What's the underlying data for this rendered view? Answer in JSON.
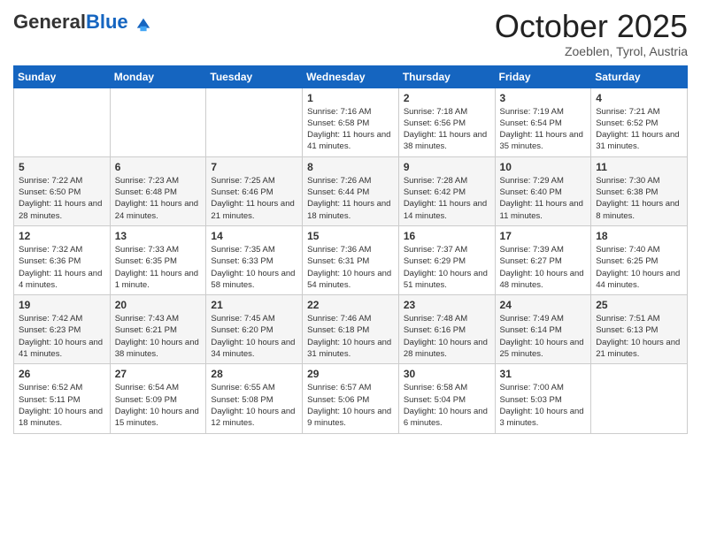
{
  "logo": {
    "general": "General",
    "blue": "Blue"
  },
  "header": {
    "month": "October 2025",
    "location": "Zoeblen, Tyrol, Austria"
  },
  "days_of_week": [
    "Sunday",
    "Monday",
    "Tuesday",
    "Wednesday",
    "Thursday",
    "Friday",
    "Saturday"
  ],
  "weeks": [
    [
      {
        "day": "",
        "info": ""
      },
      {
        "day": "",
        "info": ""
      },
      {
        "day": "",
        "info": ""
      },
      {
        "day": "1",
        "info": "Sunrise: 7:16 AM\nSunset: 6:58 PM\nDaylight: 11 hours and 41 minutes."
      },
      {
        "day": "2",
        "info": "Sunrise: 7:18 AM\nSunset: 6:56 PM\nDaylight: 11 hours and 38 minutes."
      },
      {
        "day": "3",
        "info": "Sunrise: 7:19 AM\nSunset: 6:54 PM\nDaylight: 11 hours and 35 minutes."
      },
      {
        "day": "4",
        "info": "Sunrise: 7:21 AM\nSunset: 6:52 PM\nDaylight: 11 hours and 31 minutes."
      }
    ],
    [
      {
        "day": "5",
        "info": "Sunrise: 7:22 AM\nSunset: 6:50 PM\nDaylight: 11 hours and 28 minutes."
      },
      {
        "day": "6",
        "info": "Sunrise: 7:23 AM\nSunset: 6:48 PM\nDaylight: 11 hours and 24 minutes."
      },
      {
        "day": "7",
        "info": "Sunrise: 7:25 AM\nSunset: 6:46 PM\nDaylight: 11 hours and 21 minutes."
      },
      {
        "day": "8",
        "info": "Sunrise: 7:26 AM\nSunset: 6:44 PM\nDaylight: 11 hours and 18 minutes."
      },
      {
        "day": "9",
        "info": "Sunrise: 7:28 AM\nSunset: 6:42 PM\nDaylight: 11 hours and 14 minutes."
      },
      {
        "day": "10",
        "info": "Sunrise: 7:29 AM\nSunset: 6:40 PM\nDaylight: 11 hours and 11 minutes."
      },
      {
        "day": "11",
        "info": "Sunrise: 7:30 AM\nSunset: 6:38 PM\nDaylight: 11 hours and 8 minutes."
      }
    ],
    [
      {
        "day": "12",
        "info": "Sunrise: 7:32 AM\nSunset: 6:36 PM\nDaylight: 11 hours and 4 minutes."
      },
      {
        "day": "13",
        "info": "Sunrise: 7:33 AM\nSunset: 6:35 PM\nDaylight: 11 hours and 1 minute."
      },
      {
        "day": "14",
        "info": "Sunrise: 7:35 AM\nSunset: 6:33 PM\nDaylight: 10 hours and 58 minutes."
      },
      {
        "day": "15",
        "info": "Sunrise: 7:36 AM\nSunset: 6:31 PM\nDaylight: 10 hours and 54 minutes."
      },
      {
        "day": "16",
        "info": "Sunrise: 7:37 AM\nSunset: 6:29 PM\nDaylight: 10 hours and 51 minutes."
      },
      {
        "day": "17",
        "info": "Sunrise: 7:39 AM\nSunset: 6:27 PM\nDaylight: 10 hours and 48 minutes."
      },
      {
        "day": "18",
        "info": "Sunrise: 7:40 AM\nSunset: 6:25 PM\nDaylight: 10 hours and 44 minutes."
      }
    ],
    [
      {
        "day": "19",
        "info": "Sunrise: 7:42 AM\nSunset: 6:23 PM\nDaylight: 10 hours and 41 minutes."
      },
      {
        "day": "20",
        "info": "Sunrise: 7:43 AM\nSunset: 6:21 PM\nDaylight: 10 hours and 38 minutes."
      },
      {
        "day": "21",
        "info": "Sunrise: 7:45 AM\nSunset: 6:20 PM\nDaylight: 10 hours and 34 minutes."
      },
      {
        "day": "22",
        "info": "Sunrise: 7:46 AM\nSunset: 6:18 PM\nDaylight: 10 hours and 31 minutes."
      },
      {
        "day": "23",
        "info": "Sunrise: 7:48 AM\nSunset: 6:16 PM\nDaylight: 10 hours and 28 minutes."
      },
      {
        "day": "24",
        "info": "Sunrise: 7:49 AM\nSunset: 6:14 PM\nDaylight: 10 hours and 25 minutes."
      },
      {
        "day": "25",
        "info": "Sunrise: 7:51 AM\nSunset: 6:13 PM\nDaylight: 10 hours and 21 minutes."
      }
    ],
    [
      {
        "day": "26",
        "info": "Sunrise: 6:52 AM\nSunset: 5:11 PM\nDaylight: 10 hours and 18 minutes."
      },
      {
        "day": "27",
        "info": "Sunrise: 6:54 AM\nSunset: 5:09 PM\nDaylight: 10 hours and 15 minutes."
      },
      {
        "day": "28",
        "info": "Sunrise: 6:55 AM\nSunset: 5:08 PM\nDaylight: 10 hours and 12 minutes."
      },
      {
        "day": "29",
        "info": "Sunrise: 6:57 AM\nSunset: 5:06 PM\nDaylight: 10 hours and 9 minutes."
      },
      {
        "day": "30",
        "info": "Sunrise: 6:58 AM\nSunset: 5:04 PM\nDaylight: 10 hours and 6 minutes."
      },
      {
        "day": "31",
        "info": "Sunrise: 7:00 AM\nSunset: 5:03 PM\nDaylight: 10 hours and 3 minutes."
      },
      {
        "day": "",
        "info": ""
      }
    ]
  ]
}
